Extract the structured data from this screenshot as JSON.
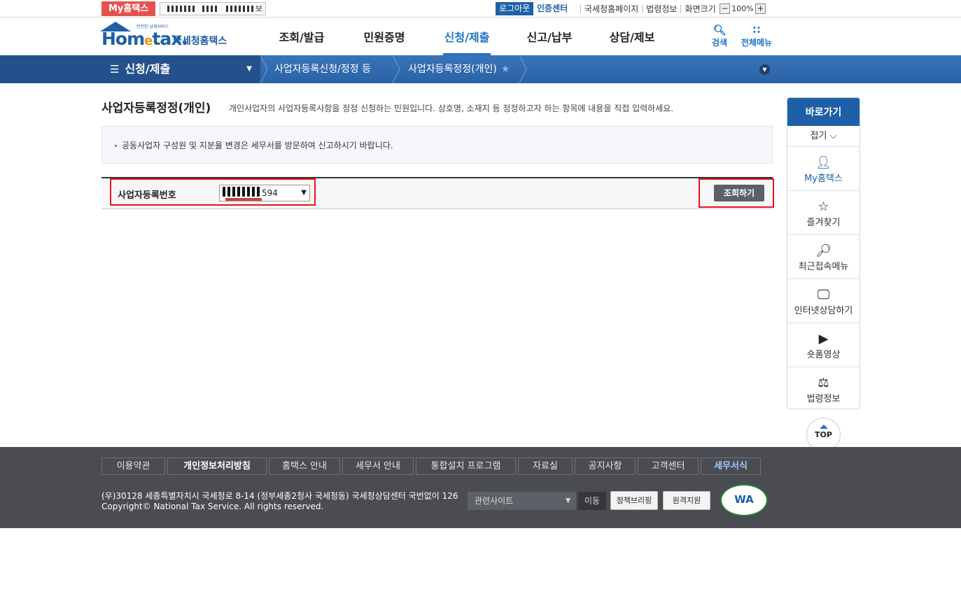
{
  "util": {
    "my_hometax": "My홈택스",
    "user_suffix": "보",
    "logout": "로그아웃",
    "cert_center": "인증센터",
    "links": [
      "국세청홈페이지",
      "법령정보",
      "화면크기"
    ],
    "zoom_minus": "−",
    "zoom_value": "100%",
    "zoom_plus": "+"
  },
  "header": {
    "logo_small": "안전한 납세서비스",
    "logo_home": "Hom",
    "logo_e": "e",
    "logo_tax": "tax.",
    "logo_kor": "국세청홈택스",
    "gnb": [
      "조회/발급",
      "민원증명",
      "신청/제출",
      "신고/납부",
      "상담/제보"
    ],
    "active_index": 2,
    "search_label": "검색",
    "menu_label": "전체메뉴"
  },
  "breadcrumb": {
    "menu_icon": "☰",
    "main": "신청/제출",
    "items": [
      "사업자등록신청/정정 등",
      "사업자등록정정(개인)"
    ]
  },
  "content": {
    "title": "사업자등록정정(개인)",
    "description": "개인사업자의 사업자등록사항을 정정 신청하는 민원입니다. 상호명, 소재지 등 정정하고자 하는 항목에 내용을 직접 입력하세요.",
    "notice": "공동사업자 구성원 및 지분율 변경은 세무서를 방문하여 신고하시기 바랍니다.",
    "brn_label": "사업자등록번호",
    "brn_value_suffix": "594",
    "lookup_button": "조회하기"
  },
  "quick": {
    "title": "바로가기",
    "fold": "접기 ⌵",
    "items": [
      {
        "label": "My홈택스",
        "icon": "person-icon"
      },
      {
        "label": "즐겨찾기",
        "icon": "star-icon"
      },
      {
        "label": "최근접속메뉴",
        "icon": "recent-icon"
      },
      {
        "label": "인터넷상담하기",
        "icon": "monitor-icon"
      },
      {
        "label": "숏폼영상",
        "icon": "play-icon"
      },
      {
        "label": "법령정보",
        "icon": "gavel-icon"
      }
    ],
    "top": "TOP"
  },
  "footer": {
    "links": [
      "이용약관",
      "개인정보처리방침",
      "홈택스 안내",
      "세무서 안내",
      "통합설치 프로그램",
      "자료실",
      "공지사항",
      "고객센터",
      "세무서식"
    ],
    "address": "(우)30128 세종특별자치시 국세청로 8-14 (정부세종2청사 국세청동) 국세청상담센터 국번없이 126",
    "copyright": "Copyright© National Tax Service. All rights reserved.",
    "related_sites": "관련사이트",
    "go": "이동",
    "policy_briefing": "정책브리핑",
    "remote_support": "원격지원",
    "wa_mark": "WA"
  }
}
